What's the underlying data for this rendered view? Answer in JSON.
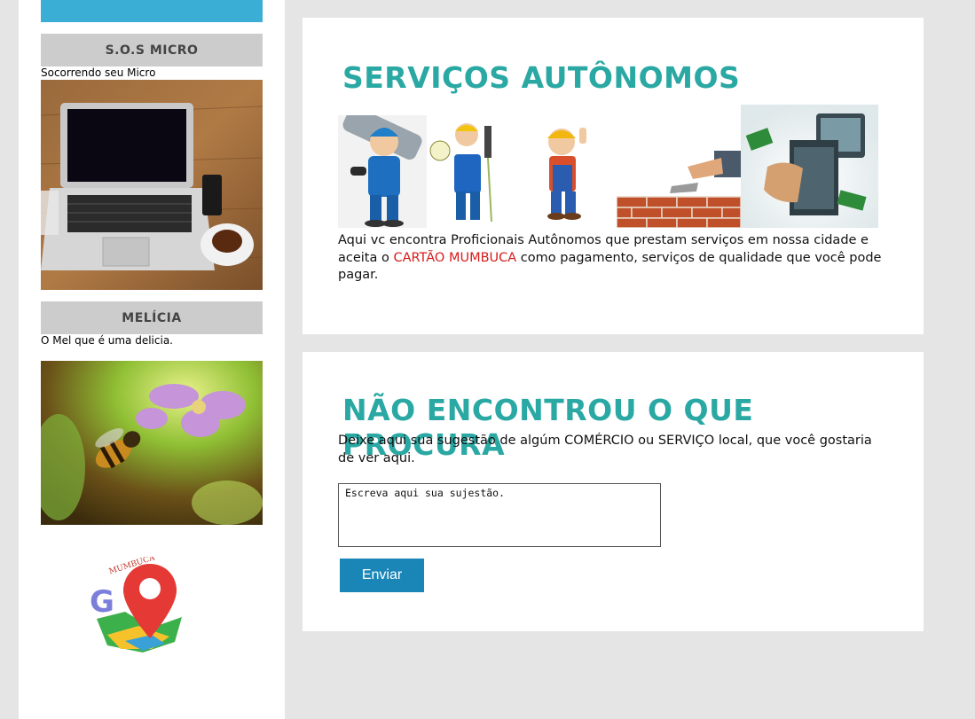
{
  "sidebar": {
    "categories": [
      {
        "title": "S.O.S MICRO",
        "description": "Socorrendo seu Micro",
        "image": "laptop-on-desk"
      },
      {
        "title": "MELÍCIA",
        "description": "O Mel que é uma delicia.",
        "image": "bee-on-flower"
      }
    ],
    "logo": {
      "text": "MUMBUCA",
      "letter": "G",
      "icon": "map-pin-logo"
    }
  },
  "services_card": {
    "title": "SERVIÇOS AUTÔNOMOS",
    "text_before": "Aqui vc encontra Proficionais Autônomos que prestam serviços em nossa cidade e aceita o ",
    "highlight": "CARTÃO MUMBUCA",
    "text_after": " como pagamento, serviços de qualidade que você pode pagar.",
    "images": [
      "mechanic-with-wrench",
      "electrician-with-plug",
      "builder-thumbs-up",
      "bricklayer-trowel",
      "computer-repair"
    ]
  },
  "suggest_card": {
    "title": "NÃO ENCONTROU O QUE PROCURA",
    "text": "Deixe aqui sua sugestão de algúm COMÉRCIO ou SERVIÇO local, que você gostaria de ver aqui.",
    "textarea_value": "Escreva aqui sua sujestão.",
    "button_label": "Enviar"
  },
  "colors": {
    "accent": "#2aa8a3",
    "button": "#1a86b8",
    "highlight": "#d81b1b",
    "topbar": "#3aaed4"
  }
}
